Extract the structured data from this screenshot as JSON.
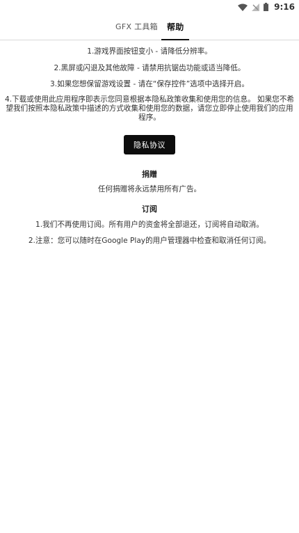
{
  "status_bar": {
    "time": "9:16"
  },
  "tabs": [
    {
      "label": "GFX 工具箱"
    },
    {
      "label": "帮助"
    }
  ],
  "help": {
    "item1": "1.游戏界面按钮变小 - 请降低分辨率。",
    "item2": "2.黑屏或闪退及其他故障 - 请禁用抗锯齿功能或适当降低。",
    "item3": "3.如果您想保留游戏设置 - 请在“保存控件”选项中选择开启。",
    "item4": "4.下载或使用此应用程序即表示您同意根据本隐私政策收集和使用您的信息。 如果您不希望我们按照本隐私政策中描述的方式收集和使用您的数据，请您立即停止使用我们的应用程序。",
    "privacy_button": "隐私协议"
  },
  "donate": {
    "title": "捐赠",
    "text": "任何捐赠将永远禁用所有广告。"
  },
  "subscription": {
    "title": "订阅",
    "item1": "1.我们不再使用订阅。所有用户的资金将全部退还，订阅将自动取消。",
    "item2": "2.注意：您可以随时在Google Play的用户管理器中检查和取消任何订阅。"
  }
}
